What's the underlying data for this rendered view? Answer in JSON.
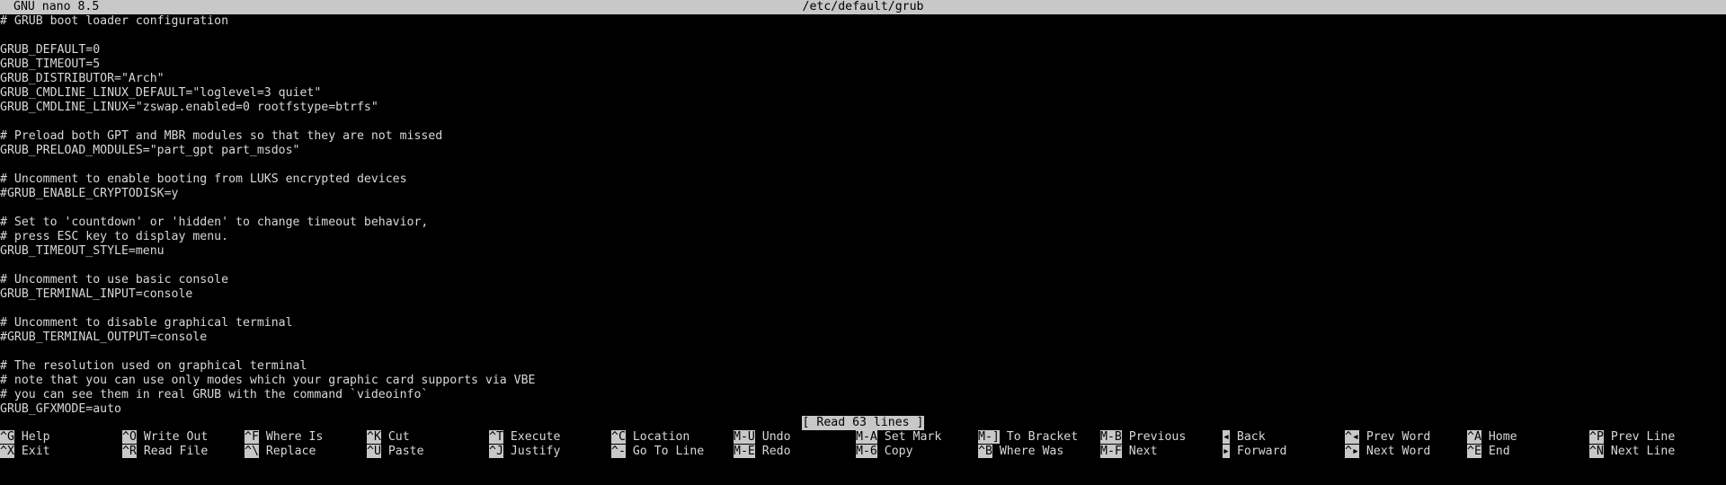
{
  "titlebar": {
    "app": "GNU nano 8.5",
    "file": "/etc/default/grub"
  },
  "editor": {
    "lines": [
      "# GRUB boot loader configuration",
      "",
      "GRUB_DEFAULT=0",
      "GRUB_TIMEOUT=5",
      "GRUB_DISTRIBUTOR=\"Arch\"",
      "GRUB_CMDLINE_LINUX_DEFAULT=\"loglevel=3 quiet\"",
      "GRUB_CMDLINE_LINUX=\"zswap.enabled=0 rootfstype=btrfs\"",
      "",
      "# Preload both GPT and MBR modules so that they are not missed",
      "GRUB_PRELOAD_MODULES=\"part_gpt part_msdos\"",
      "",
      "# Uncomment to enable booting from LUKS encrypted devices",
      "#GRUB_ENABLE_CRYPTODISK=y",
      "",
      "# Set to 'countdown' or 'hidden' to change timeout behavior,",
      "# press ESC key to display menu.",
      "GRUB_TIMEOUT_STYLE=menu",
      "",
      "# Uncomment to use basic console",
      "GRUB_TERMINAL_INPUT=console",
      "",
      "# Uncomment to disable graphical terminal",
      "#GRUB_TERMINAL_OUTPUT=console",
      "",
      "# The resolution used on graphical terminal",
      "# note that you can use only modes which your graphic card supports via VBE",
      "# you can see them in real GRUB with the command `videoinfo`",
      "GRUB_GFXMODE=auto"
    ]
  },
  "status": {
    "message": "[ Read 63 lines ]"
  },
  "shortcuts": {
    "row1": [
      {
        "key": "^G",
        "label": "Help"
      },
      {
        "key": "^O",
        "label": "Write Out"
      },
      {
        "key": "^F",
        "label": "Where Is"
      },
      {
        "key": "^K",
        "label": "Cut"
      },
      {
        "key": "^T",
        "label": "Execute"
      },
      {
        "key": "^C",
        "label": "Location"
      },
      {
        "key": "M-U",
        "label": "Undo"
      },
      {
        "key": "M-A",
        "label": "Set Mark"
      },
      {
        "key": "M-]",
        "label": "To Bracket"
      },
      {
        "key": "M-B",
        "label": "Previous"
      },
      {
        "key": "◂",
        "label": "Back"
      },
      {
        "key": "^◂",
        "label": "Prev Word"
      },
      {
        "key": "^A",
        "label": "Home"
      },
      {
        "key": "^P",
        "label": "Prev Line"
      }
    ],
    "row2": [
      {
        "key": "^X",
        "label": "Exit"
      },
      {
        "key": "^R",
        "label": "Read File"
      },
      {
        "key": "^\\",
        "label": "Replace"
      },
      {
        "key": "^U",
        "label": "Paste"
      },
      {
        "key": "^J",
        "label": "Justify"
      },
      {
        "key": "^-",
        "label": "Go To Line"
      },
      {
        "key": "M-E",
        "label": "Redo"
      },
      {
        "key": "M-6",
        "label": "Copy"
      },
      {
        "key": "^B",
        "label": "Where Was"
      },
      {
        "key": "M-F",
        "label": "Next"
      },
      {
        "key": "▸",
        "label": "Forward"
      },
      {
        "key": "^▸",
        "label": "Next Word"
      },
      {
        "key": "^E",
        "label": "End"
      },
      {
        "key": "^N",
        "label": "Next Line"
      }
    ]
  },
  "colors": {
    "background": "#000000",
    "foreground": "#d8d8d8",
    "inverse_bg": "#c8c8c8",
    "inverse_fg": "#000000"
  }
}
